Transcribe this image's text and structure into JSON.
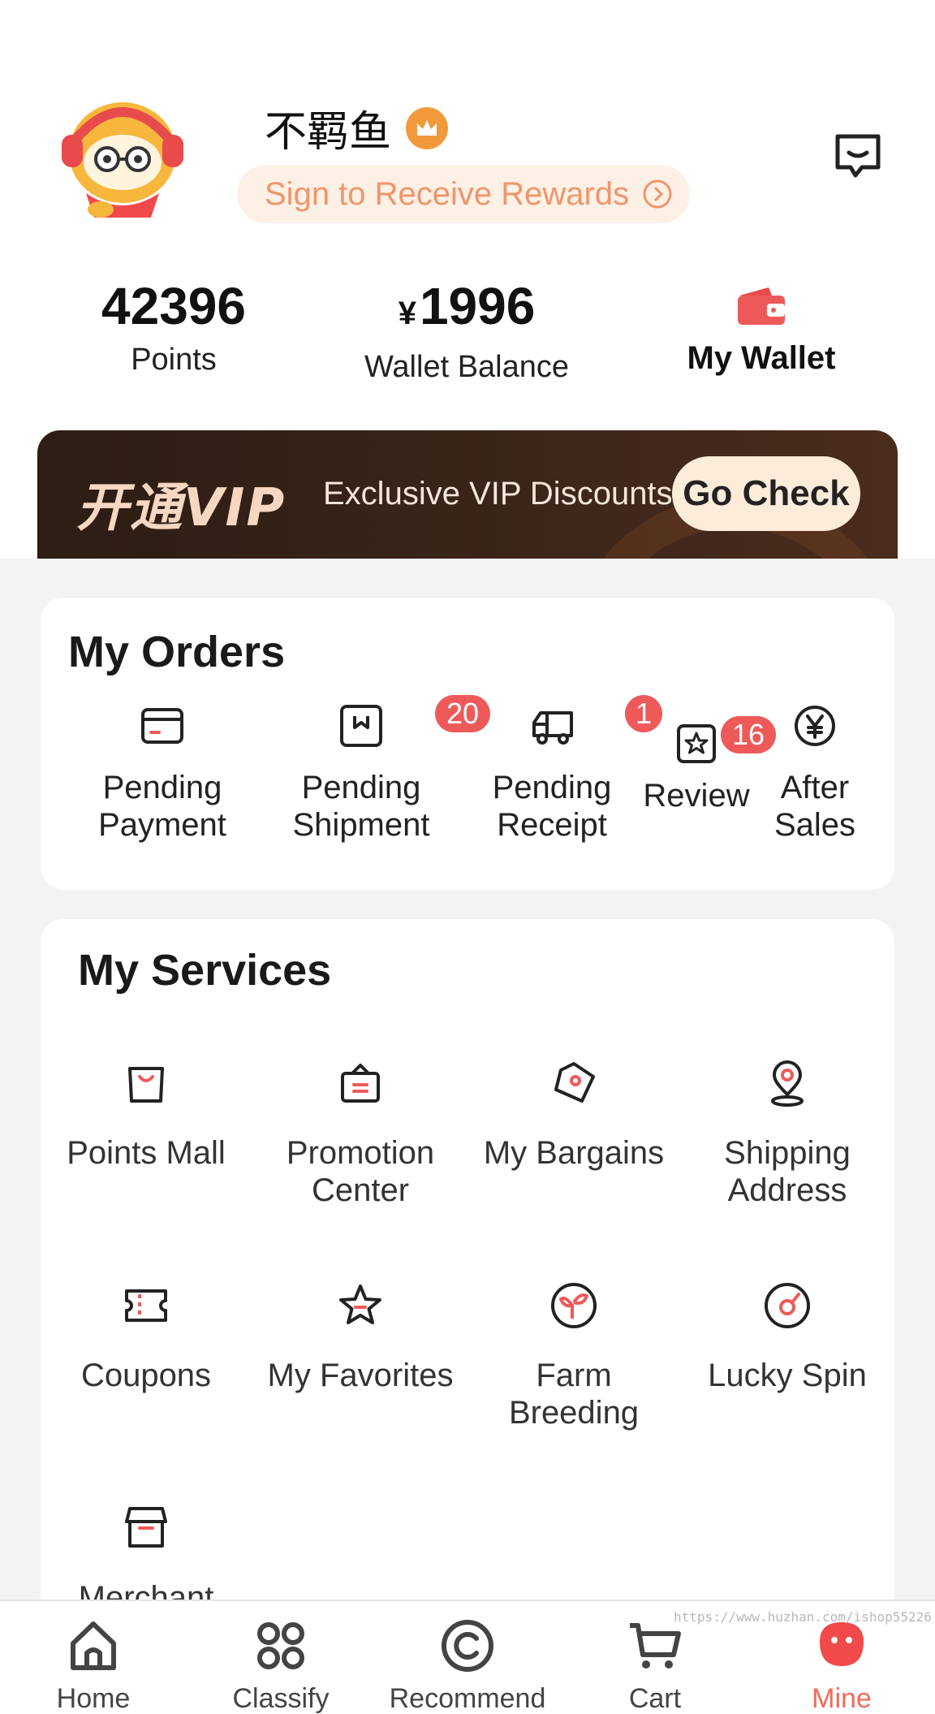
{
  "profile": {
    "username": "不羁鱼",
    "sign_button": "Sign to Receive Rewards",
    "icons": {
      "avatar": "mascot-avatar",
      "crown": "crown-icon",
      "message": "message-icon",
      "sign_arrow": "circle-arrow-icon"
    }
  },
  "stats": {
    "points_value": "42396",
    "points_label": "Points",
    "currency_symbol": "¥",
    "wallet_value": "1996",
    "wallet_label": "Wallet Balance",
    "my_wallet_label": "My Wallet"
  },
  "vip": {
    "title": "开通VIP",
    "description": "Exclusive VIP Discounts",
    "button": "Go Check"
  },
  "orders": {
    "title": "My Orders",
    "items": [
      {
        "label_line1": "Pending",
        "label_line2": "Payment",
        "icon": "card-icon",
        "badge": ""
      },
      {
        "label_line1": "Pending",
        "label_line2": "Shipment",
        "icon": "box-icon",
        "badge": "20"
      },
      {
        "label_line1": "Pending",
        "label_line2": "Receipt",
        "icon": "truck-icon",
        "badge": "1"
      },
      {
        "label_line1": "Review",
        "label_line2": "",
        "icon": "star-square-icon",
        "badge": "16"
      },
      {
        "label_line1": "After",
        "label_line2": "Sales",
        "icon": "yen-circle-icon",
        "badge": ""
      }
    ]
  },
  "services": {
    "title": "My Services",
    "items": [
      {
        "label_line1": "Points Mall",
        "label_line2": "",
        "icon": "shopping-bag-icon"
      },
      {
        "label_line1": "Promotion",
        "label_line2": "Center",
        "icon": "briefcase-icon"
      },
      {
        "label_line1": "My Bargains",
        "label_line2": "",
        "icon": "tag-icon"
      },
      {
        "label_line1": "Shipping",
        "label_line2": "Address",
        "icon": "location-pin-icon"
      },
      {
        "label_line1": "Coupons",
        "label_line2": "",
        "icon": "ticket-icon"
      },
      {
        "label_line1": "My Favorites",
        "label_line2": "",
        "icon": "star-icon"
      },
      {
        "label_line1": "Farm",
        "label_line2": "Breeding",
        "icon": "sprout-icon"
      },
      {
        "label_line1": "Lucky Spin",
        "label_line2": "",
        "icon": "spin-wheel-icon"
      },
      {
        "label_line1": "Merchant",
        "label_line2": "",
        "icon": "store-icon"
      }
    ]
  },
  "tabbar": {
    "items": [
      {
        "label": "Home",
        "icon": "home-icon"
      },
      {
        "label": "Classify",
        "icon": "grid-icon"
      },
      {
        "label": "Recommend",
        "icon": "recommend-icon"
      },
      {
        "label": "Cart",
        "icon": "cart-icon"
      },
      {
        "label": "Mine",
        "icon": "mine-icon"
      }
    ],
    "active_color": "#f26a5a"
  },
  "watermark": "https://www.huzhan.com/ishop55226",
  "colors": {
    "accent": "#ee5a5a",
    "vip_bg": "#2d1d14",
    "vip_button": "#fdecd9",
    "sign_pill": "#fdf0e4"
  }
}
